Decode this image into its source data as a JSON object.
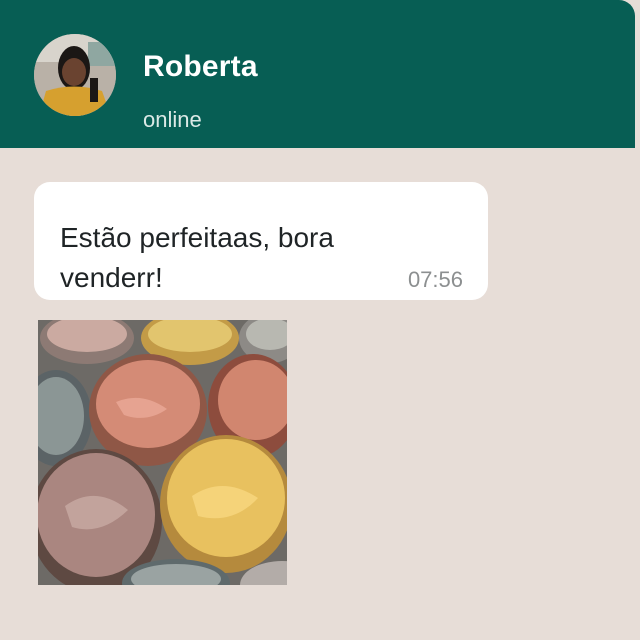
{
  "contact": {
    "name": "Roberta",
    "status": "online"
  },
  "messages": [
    {
      "text": "Estão perfeitaas, bora venderr!",
      "time": "07:56"
    }
  ],
  "colors": {
    "header": "#075e54",
    "chat_background": "#e7ddd7",
    "bubble": "#ffffff"
  }
}
